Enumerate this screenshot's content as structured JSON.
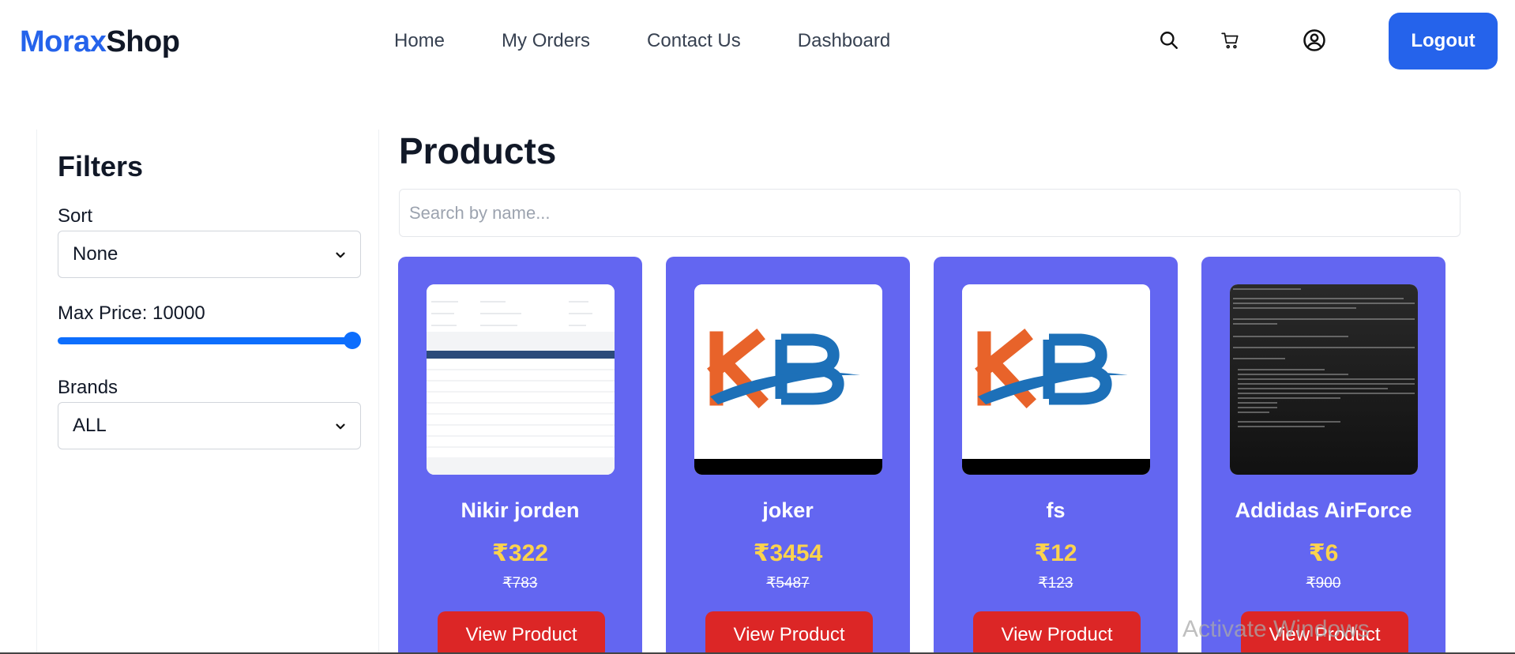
{
  "navbar": {
    "logo_part1": "Morax",
    "logo_part2": "Shop",
    "links": [
      "Home",
      "My Orders",
      "Contact Us",
      "Dashboard"
    ],
    "icons": [
      "search-icon",
      "cart-icon",
      "user-circle-icon"
    ],
    "logout_label": "Logout"
  },
  "sidebar": {
    "title": "Filters",
    "sort": {
      "label": "Sort",
      "value": "None"
    },
    "max_price": {
      "label": "Max Price: 10000",
      "value": 10000,
      "fill_fraction": 1.0
    },
    "brands": {
      "label": "Brands",
      "value": "ALL"
    }
  },
  "main": {
    "title": "Products",
    "search_placeholder": "Search by name...",
    "products": [
      {
        "name": "Nikir jorden",
        "price": "₹322",
        "old_price": "₹783",
        "button": "View Product"
      },
      {
        "name": "joker",
        "price": "₹3454",
        "old_price": "₹5487",
        "button": "View Product"
      },
      {
        "name": "fs",
        "price": "₹12",
        "old_price": "₹123",
        "button": "View Product"
      },
      {
        "name": "Addidas AirForce",
        "price": "₹6",
        "old_price": "₹900",
        "button": "View Product"
      }
    ]
  },
  "watermark": "Activate Windows",
  "colors": {
    "brand_blue": "#2563eb",
    "card_bg": "#6366f1",
    "price_yellow": "#fcd34d",
    "button_red": "#dc2626",
    "slider_blue": "#0d6efd"
  }
}
